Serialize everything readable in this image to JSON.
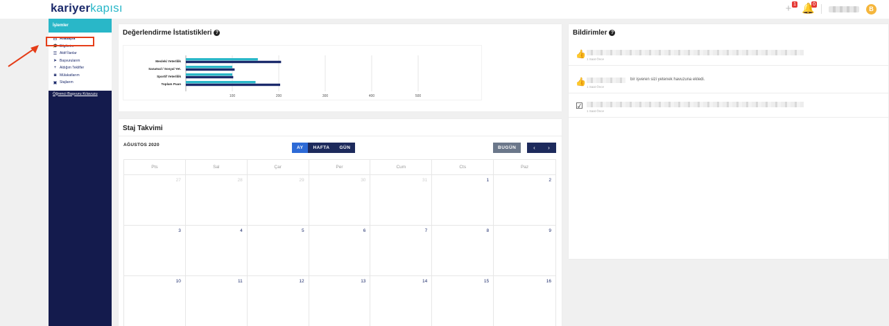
{
  "header": {
    "logo_bold": "kariyer",
    "logo_light": "kapısı",
    "add_badge": "1",
    "bell_badge": "0",
    "avatar_letter": "B"
  },
  "sidebar": {
    "heading": "İşlemler",
    "items": [
      {
        "icon": "monitor-icon",
        "glyph": "▭",
        "label": "Anasayfa"
      },
      {
        "icon": "graduation-cap-icon",
        "glyph": "🎓",
        "label": "Bilgilerim"
      },
      {
        "icon": "list-icon",
        "glyph": "☰",
        "label": "Aktif İlanlar"
      },
      {
        "icon": "paper-plane-icon",
        "glyph": "➤",
        "label": "Başvurularım"
      },
      {
        "icon": "plus-icon",
        "glyph": "+",
        "label": "Aldığım Teklifler"
      },
      {
        "icon": "camera-icon",
        "glyph": "◙",
        "label": "Mülakatlarım"
      },
      {
        "icon": "briefcase-icon",
        "glyph": "▣",
        "label": "Stajlarım"
      }
    ],
    "guide_link": "Öğrenci Başvuru Kılavuzu"
  },
  "stats_card": {
    "title": "Değerlendirme İstatistikleri"
  },
  "chart_data": {
    "type": "bar",
    "orientation": "horizontal",
    "categories": [
      "Mesleki Yeterlilik",
      "Sanatsal / Sosyal Yet.",
      "Sportif Yeterlilik",
      "Toplam Puan"
    ],
    "series": [
      {
        "color": "#29b7c8",
        "values": [
          155,
          100,
          100,
          150
        ]
      },
      {
        "color": "#1b2a6b",
        "values": [
          205,
          105,
          102,
          203
        ]
      }
    ],
    "xticks": [
      100,
      200,
      300,
      400,
      500
    ],
    "xlim": [
      0,
      620
    ],
    "grid": true
  },
  "calendar": {
    "title": "Staj Takvimi",
    "month_label": "AĞUSTOS 2020",
    "views": [
      "AY",
      "HAFTA",
      "GÜN"
    ],
    "active_view": "AY",
    "today_label": "BUGÜN",
    "prev_glyph": "‹",
    "next_glyph": "›",
    "weekdays": [
      "Pts",
      "Sal",
      "Çar",
      "Per",
      "Cum",
      "Cts",
      "Paz"
    ],
    "weeks": [
      [
        {
          "d": "27",
          "o": true
        },
        {
          "d": "28",
          "o": true
        },
        {
          "d": "29",
          "o": true
        },
        {
          "d": "30",
          "o": true
        },
        {
          "d": "31",
          "o": true
        },
        {
          "d": "1",
          "o": false
        },
        {
          "d": "2",
          "o": false
        }
      ],
      [
        {
          "d": "3",
          "o": false
        },
        {
          "d": "4",
          "o": false
        },
        {
          "d": "5",
          "o": false
        },
        {
          "d": "6",
          "o": false
        },
        {
          "d": "7",
          "o": false
        },
        {
          "d": "8",
          "o": false
        },
        {
          "d": "9",
          "o": false
        }
      ],
      [
        {
          "d": "10",
          "o": false
        },
        {
          "d": "11",
          "o": false
        },
        {
          "d": "12",
          "o": false
        },
        {
          "d": "13",
          "o": false
        },
        {
          "d": "14",
          "o": false
        },
        {
          "d": "15",
          "o": false
        },
        {
          "d": "16",
          "o": false
        }
      ]
    ]
  },
  "notifications": {
    "title": "Bildirimler",
    "items": [
      {
        "icon": "thumbs-up-icon",
        "glyph": "👍",
        "text": "",
        "time": "1 Saat Önce"
      },
      {
        "icon": "thumbs-up-icon",
        "glyph": "👍",
        "text": "bir işveren sizi yetenek havuzuna ekledi.",
        "time": "1 Saat Önce"
      },
      {
        "icon": "check-square-icon",
        "glyph": "☑",
        "text": "",
        "time": "1 Saat Önce"
      }
    ]
  }
}
